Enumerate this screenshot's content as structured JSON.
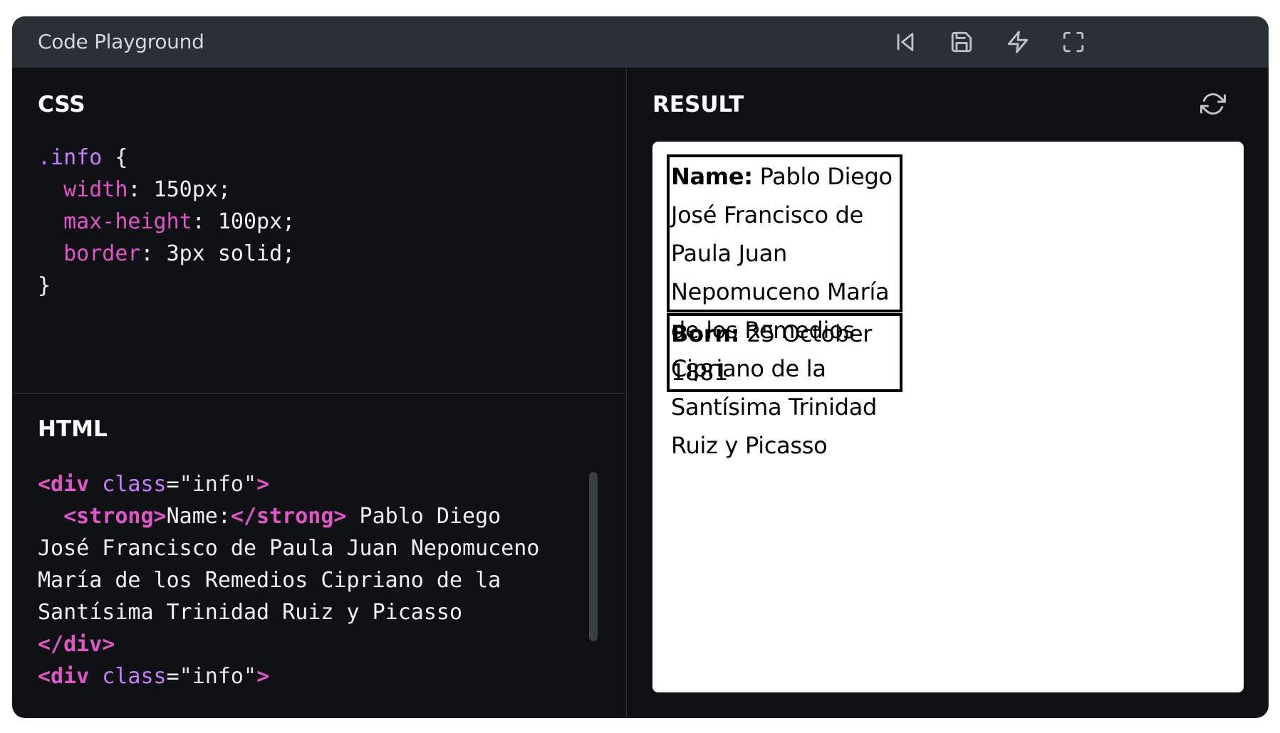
{
  "app": {
    "title": "Code Playground"
  },
  "toolbar": {
    "icons": [
      "skip-back-icon",
      "save-icon",
      "bolt-icon",
      "fullscreen-icon"
    ]
  },
  "css_panel": {
    "heading": "CSS",
    "lines": [
      {
        "selector": ".info",
        "open": " {"
      },
      {
        "prop": "width",
        "value": ": 150px;"
      },
      {
        "prop": "max-height",
        "value": ": 100px;"
      },
      {
        "prop": "border",
        "value": ": 3px solid;"
      },
      {
        "close": "}"
      }
    ]
  },
  "html_panel": {
    "heading": "HTML",
    "code": {
      "div_open_tag": "<div",
      "class_attr": " class",
      "class_eq": "=",
      "class_value": "\"info\"",
      "tag_close": ">",
      "strong_open": "<strong>",
      "name_label": "Name:",
      "strong_close": "</strong>",
      "name_text_1": " Pablo Diego",
      "name_text_2": "José Francisco de Paula Juan Nepomuceno",
      "name_text_3": "María de los Remedios Cipriano de la",
      "name_text_4": "Santísima Trinidad Ruiz y Picasso",
      "div_close": "</div>"
    }
  },
  "result_panel": {
    "heading": "RESULT",
    "first_box": {
      "label": "Name:",
      "lines": [
        " Pablo Diego",
        "José Francisco de",
        "Paula Juan",
        "Nepomuceno María",
        "de los Remedios",
        "Cipriano de la",
        "Santísima Trinidad",
        "Ruiz y Picasso"
      ]
    },
    "second_box": {
      "label": "Born:",
      "lines": [
        " 25 October",
        "1881"
      ]
    }
  },
  "colors": {
    "titlebar": "#2b2f36",
    "panel_bg": "#0f1114",
    "selector": "#c77dff",
    "property": "#e255c8",
    "tag": "#e255c8"
  }
}
